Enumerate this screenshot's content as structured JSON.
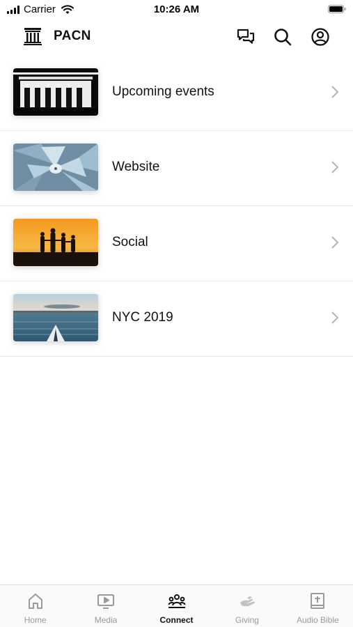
{
  "status_bar": {
    "carrier": "Carrier",
    "time": "10:26 AM"
  },
  "header": {
    "title": "PACN"
  },
  "list_items": [
    {
      "label": "Upcoming events"
    },
    {
      "label": "Website"
    },
    {
      "label": "Social"
    },
    {
      "label": "NYC 2019"
    }
  ],
  "tabs": [
    {
      "label": "Home",
      "icon": "home-icon"
    },
    {
      "label": "Media",
      "icon": "media-icon"
    },
    {
      "label": "Connect",
      "icon": "connect-icon"
    },
    {
      "label": "Giving",
      "icon": "giving-icon"
    },
    {
      "label": "Audio Bible",
      "icon": "bible-icon"
    }
  ],
  "active_tab": "Connect",
  "colors": {
    "active": "#111111",
    "inactive": "#9a9a9a",
    "divider": "#e9e9e9"
  }
}
